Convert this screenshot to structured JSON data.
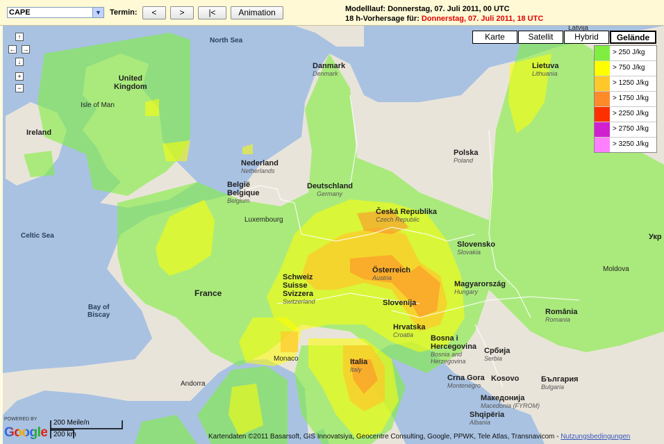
{
  "toolbar": {
    "parameter": "CAPE",
    "termin_label": "Termin:",
    "prev_label": "<",
    "next_label": ">",
    "first_label": "|<",
    "animation_label": "Animation",
    "run_line": "Modelllauf: Donnerstag, 07. Juli 2011, 00 UTC",
    "forecast_prefix": "18 h-Vorhersage für: ",
    "forecast_time": "Donnerstag, 07. Juli 2011, 18 UTC"
  },
  "map_types": {
    "karte": "Karte",
    "satellit": "Satellit",
    "hybrid": "Hybrid",
    "gelaende": "Gelände",
    "active": "Gelände"
  },
  "nav": {
    "up": "↑",
    "left": "←",
    "right": "→",
    "down": "↓",
    "zoom_in": "+",
    "zoom_out": "−"
  },
  "legend": [
    {
      "label": "> 250 J/kg",
      "color": "#80ee40"
    },
    {
      "label": "> 750 J/kg",
      "color": "#ffff00"
    },
    {
      "label": "> 1250 J/kg",
      "color": "#ffc82a"
    },
    {
      "label": "> 1750 J/kg",
      "color": "#ff8a2a"
    },
    {
      "label": "> 2250 J/kg",
      "color": "#ff3000"
    },
    {
      "label": "> 2750 J/kg",
      "color": "#d020d0"
    },
    {
      "label": "> 3250 J/kg",
      "color": "#ff80ff"
    }
  ],
  "seas": {
    "north_sea": "North Sea",
    "celtic_sea": "Celtic Sea",
    "bay_of_biscay_1": "Bay of",
    "bay_of_biscay_2": "Biscay"
  },
  "places": {
    "uk_1": "United",
    "uk_2": "Kingdom",
    "isle_of_man": "Isle of Man",
    "ireland": "Ireland",
    "denmark": "Danmark",
    "denmark_sub": "Denmark",
    "netherlands": "Nederland",
    "netherlands_sub": "Netherlands",
    "belgium_1": "België",
    "belgium_2": "Belgique",
    "belgium_sub": "Belgium",
    "luxembourg": "Luxembourg",
    "germany": "Deutschland",
    "germany_sub": "Germany",
    "poland": "Polska",
    "poland_sub": "Poland",
    "lithuania": "Lietuva",
    "lithuania_sub": "Lithuania",
    "latvia": "Latvija",
    "czech": "Česká Republika",
    "czech_sub": "Czech Republic",
    "slovakia": "Slovensko",
    "slovakia_sub": "Slovakia",
    "austria": "Österreich",
    "austria_sub": "Austria",
    "switzerland_1": "Schweiz",
    "switzerland_2": "Suisse",
    "switzerland_3": "Svizzera",
    "switzerland_sub": "Switzerland",
    "hungary": "Magyarország",
    "hungary_sub": "Hungary",
    "france": "France",
    "slovenia": "Slovenija",
    "croatia": "Hrvatska",
    "croatia_sub": "Croatia",
    "romania": "România",
    "romania_sub": "Romania",
    "moldova": "Moldova",
    "ukraine": "Укр",
    "bosnia_1": "Bosna i",
    "bosnia_2": "Hercegovina",
    "bosnia_sub_1": "Bosnia and",
    "bosnia_sub_2": "Herzegovina",
    "serbia": "Србија",
    "serbia_sub": "Serbia",
    "montenegro": "Crna Gora",
    "montenegro_sub": "Montenegro",
    "kosovo": "Kosovo",
    "macedonia": "Македонија",
    "macedonia_sub": "Macedonia (FYROM)",
    "bulgaria": "България",
    "bulgaria_sub": "Bulgaria",
    "albania": "Shqipëria",
    "albania_sub": "Albania",
    "monaco": "Monaco",
    "italy": "Italia",
    "italy_sub": "Italy",
    "andorra": "Andorra"
  },
  "bottom": {
    "powered_by": "POWERED BY",
    "google": "Google",
    "scale_miles": "200 Meile/n",
    "scale_km": "200 km",
    "copyright": "Kartendaten ©2011 Basarsoft, GIS Innovatsiya, Geocentre Consulting, Google, PPWK, Tele Atlas, Transnavicom - ",
    "terms": "Nutzungsbedingungen"
  }
}
